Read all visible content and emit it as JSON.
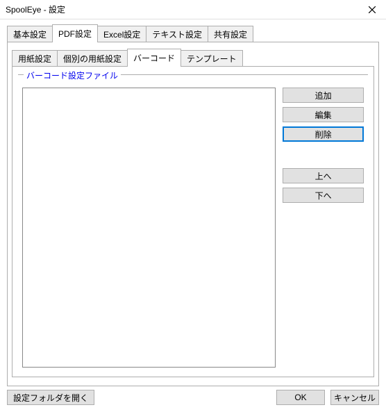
{
  "window": {
    "title": "SpoolEye - 設定"
  },
  "outerTabs": {
    "items": [
      {
        "label": "基本設定"
      },
      {
        "label": "PDF設定"
      },
      {
        "label": "Excel設定"
      },
      {
        "label": "テキスト設定"
      },
      {
        "label": "共有設定"
      }
    ],
    "activeIndex": 1
  },
  "innerTabs": {
    "items": [
      {
        "label": "用紙設定"
      },
      {
        "label": "個別の用紙設定"
      },
      {
        "label": "バーコード"
      },
      {
        "label": "テンプレート"
      }
    ],
    "activeIndex": 2
  },
  "group": {
    "legend": "バーコード設定ファイル"
  },
  "buttons": {
    "add": "追加",
    "edit": "編集",
    "delete": "削除",
    "up": "上へ",
    "down": "下へ"
  },
  "footer": {
    "openFolder": "設定フォルダを開く",
    "ok": "OK",
    "cancel": "キャンセル"
  },
  "list": {
    "items": []
  }
}
